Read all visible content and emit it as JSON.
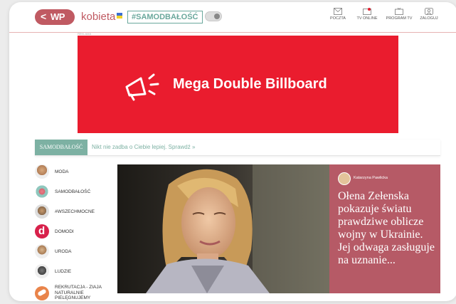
{
  "header": {
    "back_glyph": "<",
    "logo_text": "WP",
    "brand": "kobieta",
    "flag_icon": "ukraine-flag-icon",
    "tag": "#SAMODBAŁOŚĆ",
    "nav": [
      {
        "label": "POCZTA",
        "icon": "mail-icon"
      },
      {
        "label": "TV ONLINE",
        "icon": "tv-live-icon"
      },
      {
        "label": "PROGRAM TV",
        "icon": "tv-icon"
      },
      {
        "label": "ZALOGUJ",
        "icon": "user-icon"
      }
    ]
  },
  "ad": {
    "label": "REKLAMA",
    "text": "Mega Double Billboard",
    "icon": "megaphone-icon",
    "color": "#ea1c2e"
  },
  "strip": {
    "tag": "SAMODBAŁOŚĆ",
    "text": "Nikt nie zadba o Ciebie lepiej. Sprawdź »",
    "color": "#7db1a3"
  },
  "sidebar": {
    "items": [
      {
        "label": "MODA"
      },
      {
        "label": "SAMODBAŁOŚĆ"
      },
      {
        "label": "#WSZECHMOCNE"
      },
      {
        "label": "DOMODI"
      },
      {
        "label": "URODA"
      },
      {
        "label": "LUDZIE"
      },
      {
        "label": "REKRUTACJA - ZIAJA NATURALNIE PIELĘGNUJEMY"
      }
    ]
  },
  "feature": {
    "author": "Katarzyna Pawlicka",
    "headline": "Ołena Zełenska pokazuje światu prawdziwe oblicze wojny w Ukrainie. Jej odwaga zasługuje na uznanie...",
    "card_color": "#b65a66"
  }
}
